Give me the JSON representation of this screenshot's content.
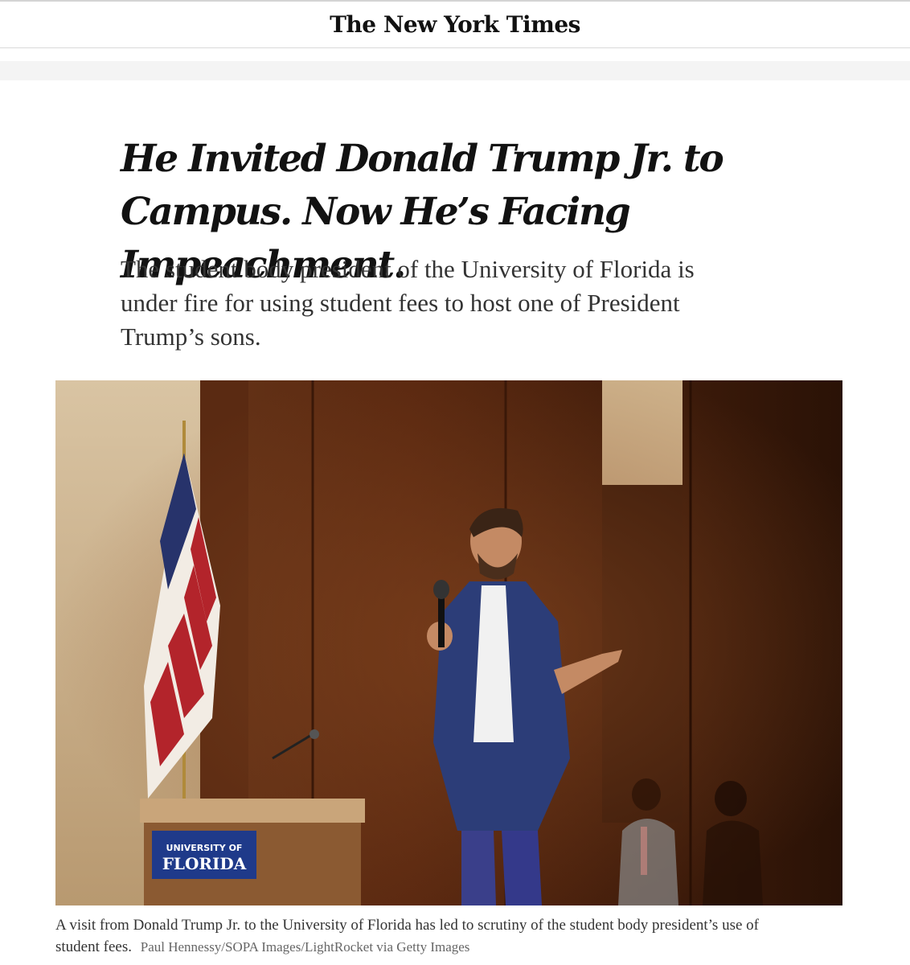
{
  "masthead": {
    "logo_text": "The New York Times"
  },
  "article": {
    "headline": "He Invited Donald Trump Jr. to Campus. Now He’s Facing Impeachment.",
    "summary": "The student body president of the University of Florida is under fire for using student fees to host one of President Trump’s sons.",
    "photo": {
      "podium_sign_line1": "UNIVERSITY OF",
      "podium_sign_line2": "FLORIDA"
    },
    "caption": "A visit from Donald Trump Jr. to the University of Florida has led to scrutiny of the student body president’s use of student fees.",
    "credit": "Paul Hennessy/SOPA Images/LightRocket via Getty Images"
  },
  "colors": {
    "stage_wall": "#4a200e",
    "suit": "#2c3d78",
    "podium_sign": "#1f3a8a"
  }
}
